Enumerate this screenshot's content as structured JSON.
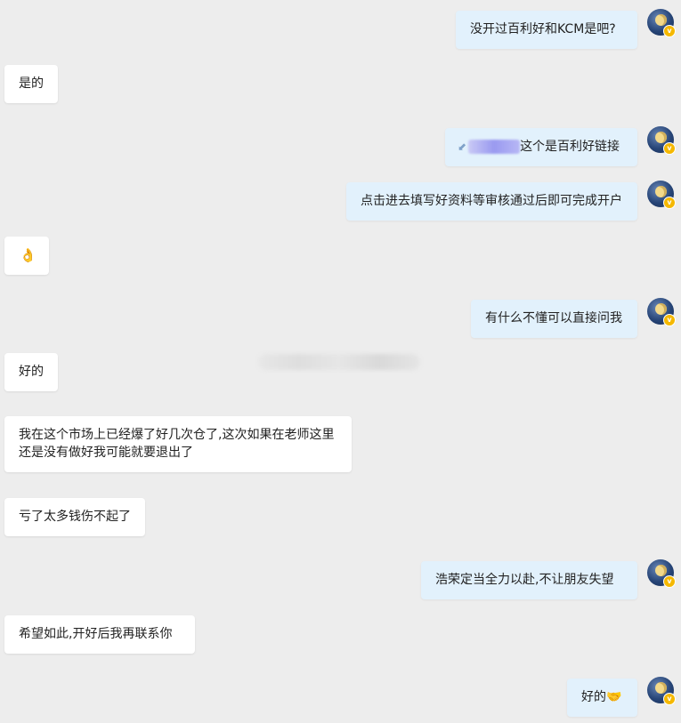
{
  "messages": [
    {
      "id": "m1",
      "side": "right",
      "text": "没开过百利好和KCM是吧?"
    },
    {
      "id": "m2",
      "side": "left",
      "text": "是的"
    },
    {
      "id": "m3",
      "side": "right",
      "link_mark": "⬋",
      "text": "这个是百利好链接"
    },
    {
      "id": "m4",
      "side": "right",
      "text": "点击进去填写好资料等审核通过后即可完成开户"
    },
    {
      "id": "m5",
      "side": "left",
      "emoji": "👌"
    },
    {
      "id": "m6",
      "side": "right",
      "text": "有什么不懂可以直接问我"
    },
    {
      "id": "m7",
      "side": "left",
      "text": "好的"
    },
    {
      "id": "m8",
      "side": "left",
      "text": "我在这个市场上已经爆了好几次仓了,这次如果在老师这里还是没有做好我可能就要退出了"
    },
    {
      "id": "m9",
      "side": "left",
      "text": "亏了太多钱伤不起了"
    },
    {
      "id": "m10",
      "side": "right",
      "text": "浩荣定当全力以赴,不让朋友失望"
    },
    {
      "id": "m11",
      "side": "left",
      "text": "希望如此,开好后我再联系你"
    },
    {
      "id": "m12",
      "side": "right",
      "text": "好的",
      "emoji": "🤝"
    }
  ],
  "avatar": {
    "badge": "v",
    "colors": {
      "ring": "#274577",
      "moon": "#f3d98a",
      "badge": "#f5b800"
    }
  },
  "colors": {
    "background": "#ededed",
    "left_bubble": "#ffffff",
    "right_bubble": "#e2f1fc",
    "text": "#222222"
  }
}
